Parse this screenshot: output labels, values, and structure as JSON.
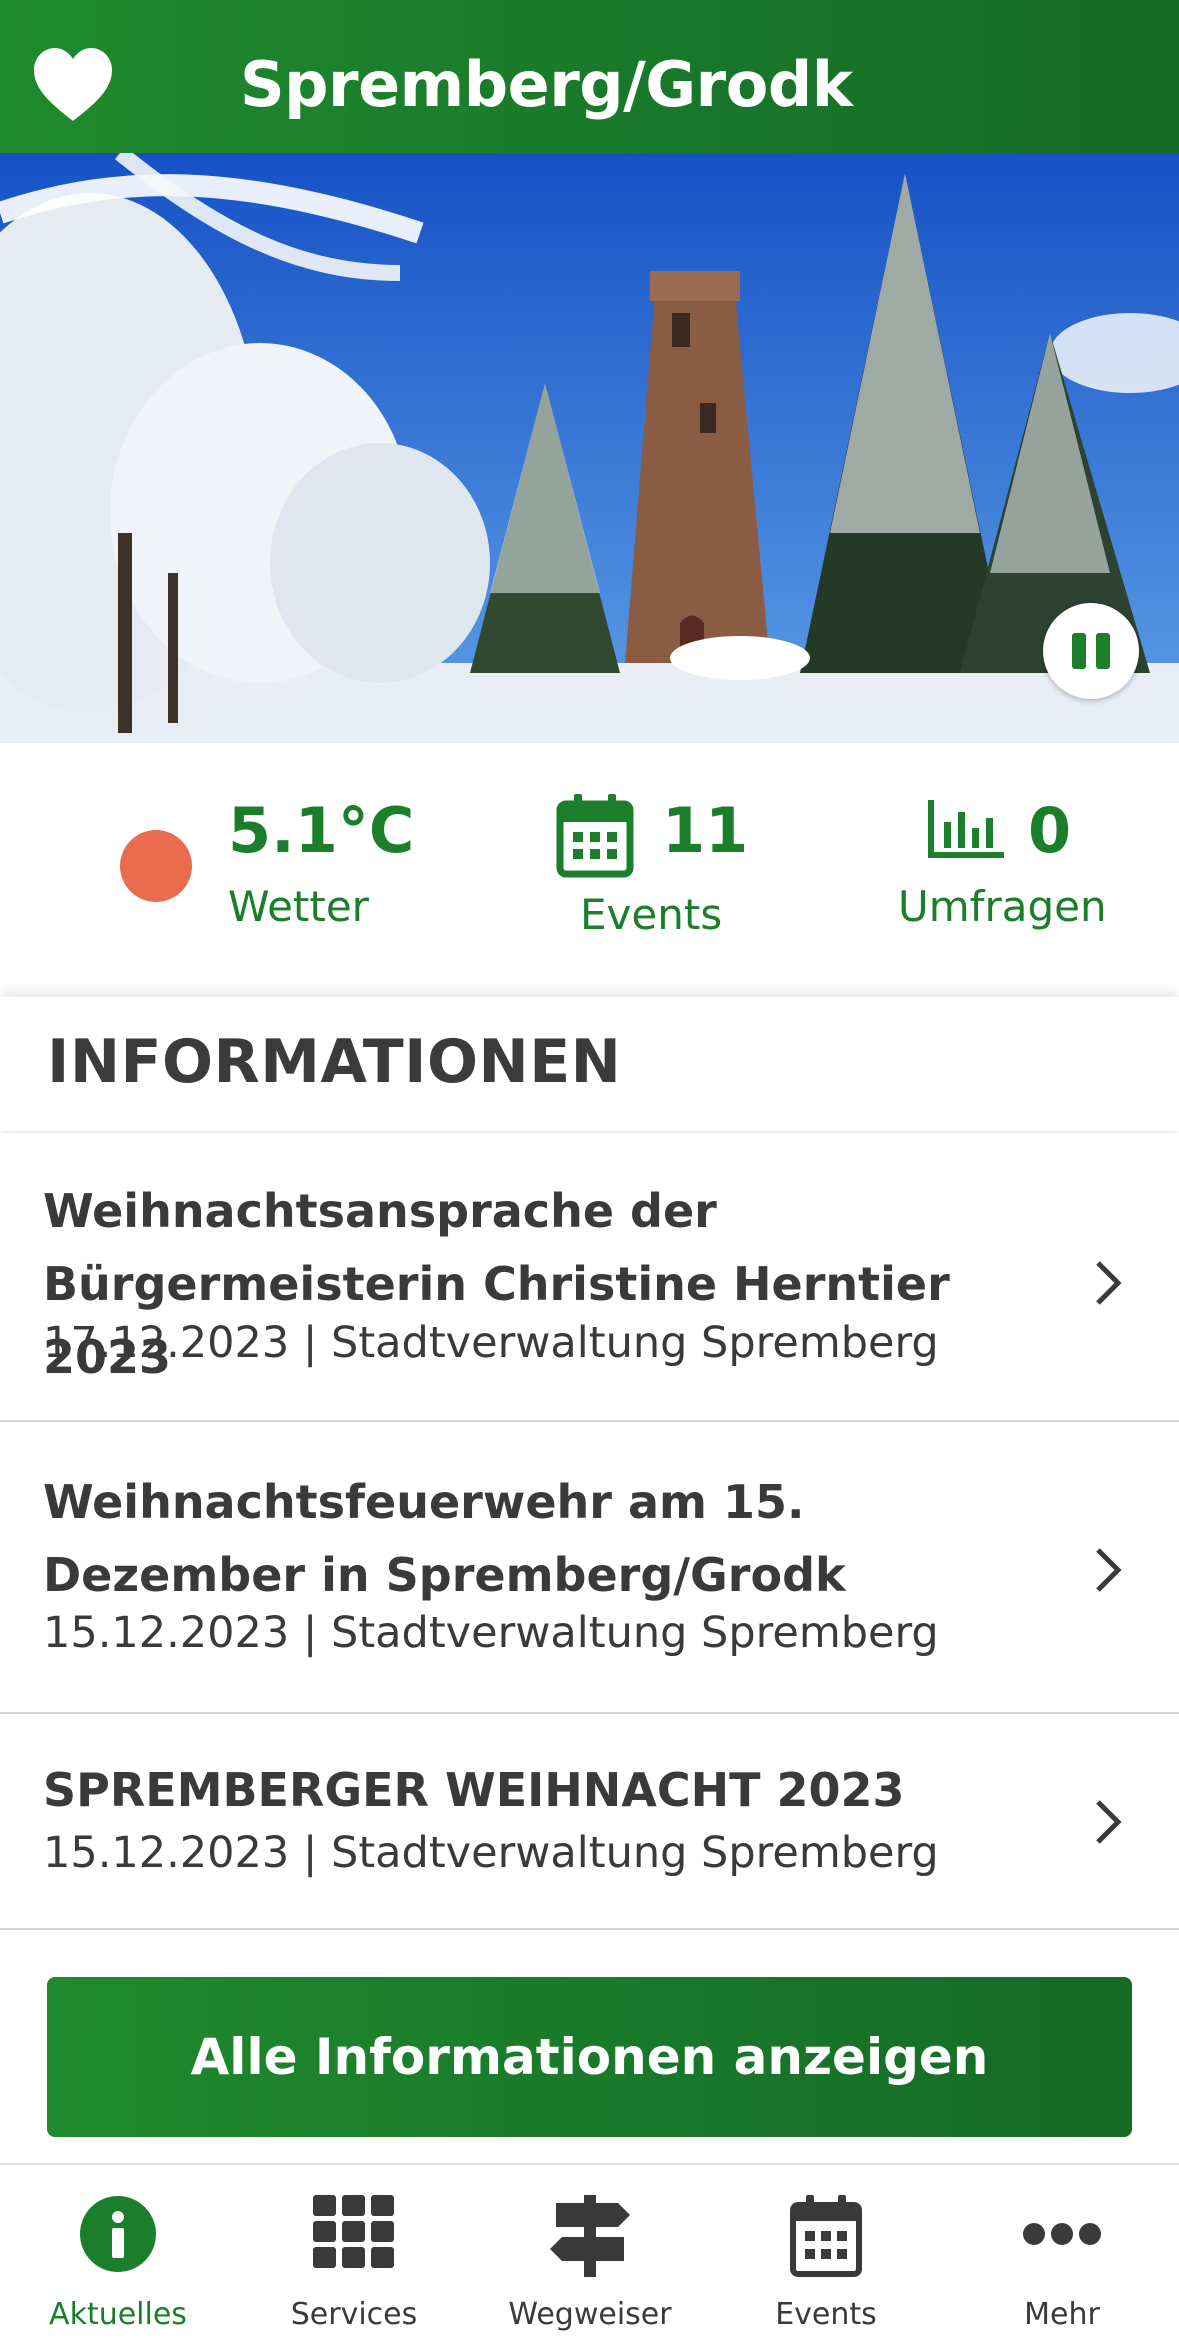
{
  "header": {
    "title": "Spremberg/Grodk",
    "favorite_icon": "heart-icon"
  },
  "hero": {
    "pause_icon": "pause-icon"
  },
  "stats": {
    "weather": {
      "value": "5.1°C",
      "label": "Wetter",
      "color": "#ea6c4f"
    },
    "events": {
      "value": "11",
      "label": "Events",
      "icon": "calendar-icon"
    },
    "polls": {
      "value": "0",
      "label": "Umfragen",
      "icon": "bar-chart-icon"
    }
  },
  "section": {
    "heading": "INFORMATIONEN"
  },
  "news": [
    {
      "title": "Weihnachtsansprache der Bürgermeisterin Christine Herntier 2023",
      "meta": "17.12.2023 | Stadtverwaltung Spremberg"
    },
    {
      "title": "Weihnachtsfeuerwehr am 15. Dezember in Spremberg/Grodk",
      "meta": "15.12.2023 | Stadtverwaltung Spremberg"
    },
    {
      "title": "SPREMBERGER WEIHNACHT 2023",
      "meta": "15.12.2023 | Stadtverwaltung Spremberg"
    }
  ],
  "cta": {
    "label": "Alle Informationen anzeigen"
  },
  "tabs": [
    {
      "label": "Aktuelles",
      "icon": "info-icon",
      "active": true
    },
    {
      "label": "Services",
      "icon": "grid-icon",
      "active": false
    },
    {
      "label": "Wegweiser",
      "icon": "signpost-icon",
      "active": false
    },
    {
      "label": "Events",
      "icon": "calendar-icon",
      "active": false
    },
    {
      "label": "Mehr",
      "icon": "more-icon",
      "active": false
    }
  ],
  "colors": {
    "brand_green": "#1b7e2b",
    "text_dark": "#3a3a3a"
  }
}
